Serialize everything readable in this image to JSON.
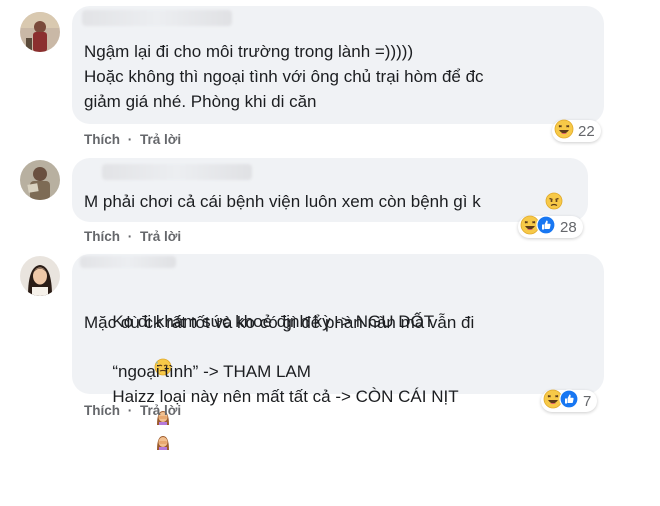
{
  "comments": [
    {
      "lines": [
        "Ngậm lại đi cho môi trường trong lành =)))))",
        "Hoặc không thì ngoại tình với ông chủ trại hòm để đc",
        "giảm giá nhé. Phòng khi di căn"
      ],
      "like_label": "Thích",
      "reply_label": "Trả lời",
      "reaction_count": "22",
      "reactions": [
        "haha-icon"
      ]
    },
    {
      "lines": [
        "M phải chơi cả cái bệnh viện luôn xem còn bệnh gì k"
      ],
      "like_label": "Thích",
      "reply_label": "Trả lời",
      "reaction_count": "28",
      "reactions": [
        "haha-icon",
        "like-icon"
      ]
    },
    {
      "name_partial": "Kim Thanh",
      "lines": [
        "Ko đi khám sức khoẻ định kỳ -> NGU DỐT",
        "Mặc dù ck rất tốt và ko có gì để phàn nàn mà vẫn đi",
        "“ngoại tình” -> THAM LAM",
        "Haizz loại này nên mất tất cả -> CÒN CÁI NỊT"
      ],
      "like_label": "Thích",
      "reply_label": "Trả lời",
      "reaction_count": "7",
      "reactions": [
        "haha-icon",
        "like-icon"
      ]
    }
  ],
  "colors": {
    "bubble": "#f0f2f5",
    "meta_text": "#65676b",
    "like_blue": "#1877f2",
    "emoji_yellow": "#f7c948"
  }
}
